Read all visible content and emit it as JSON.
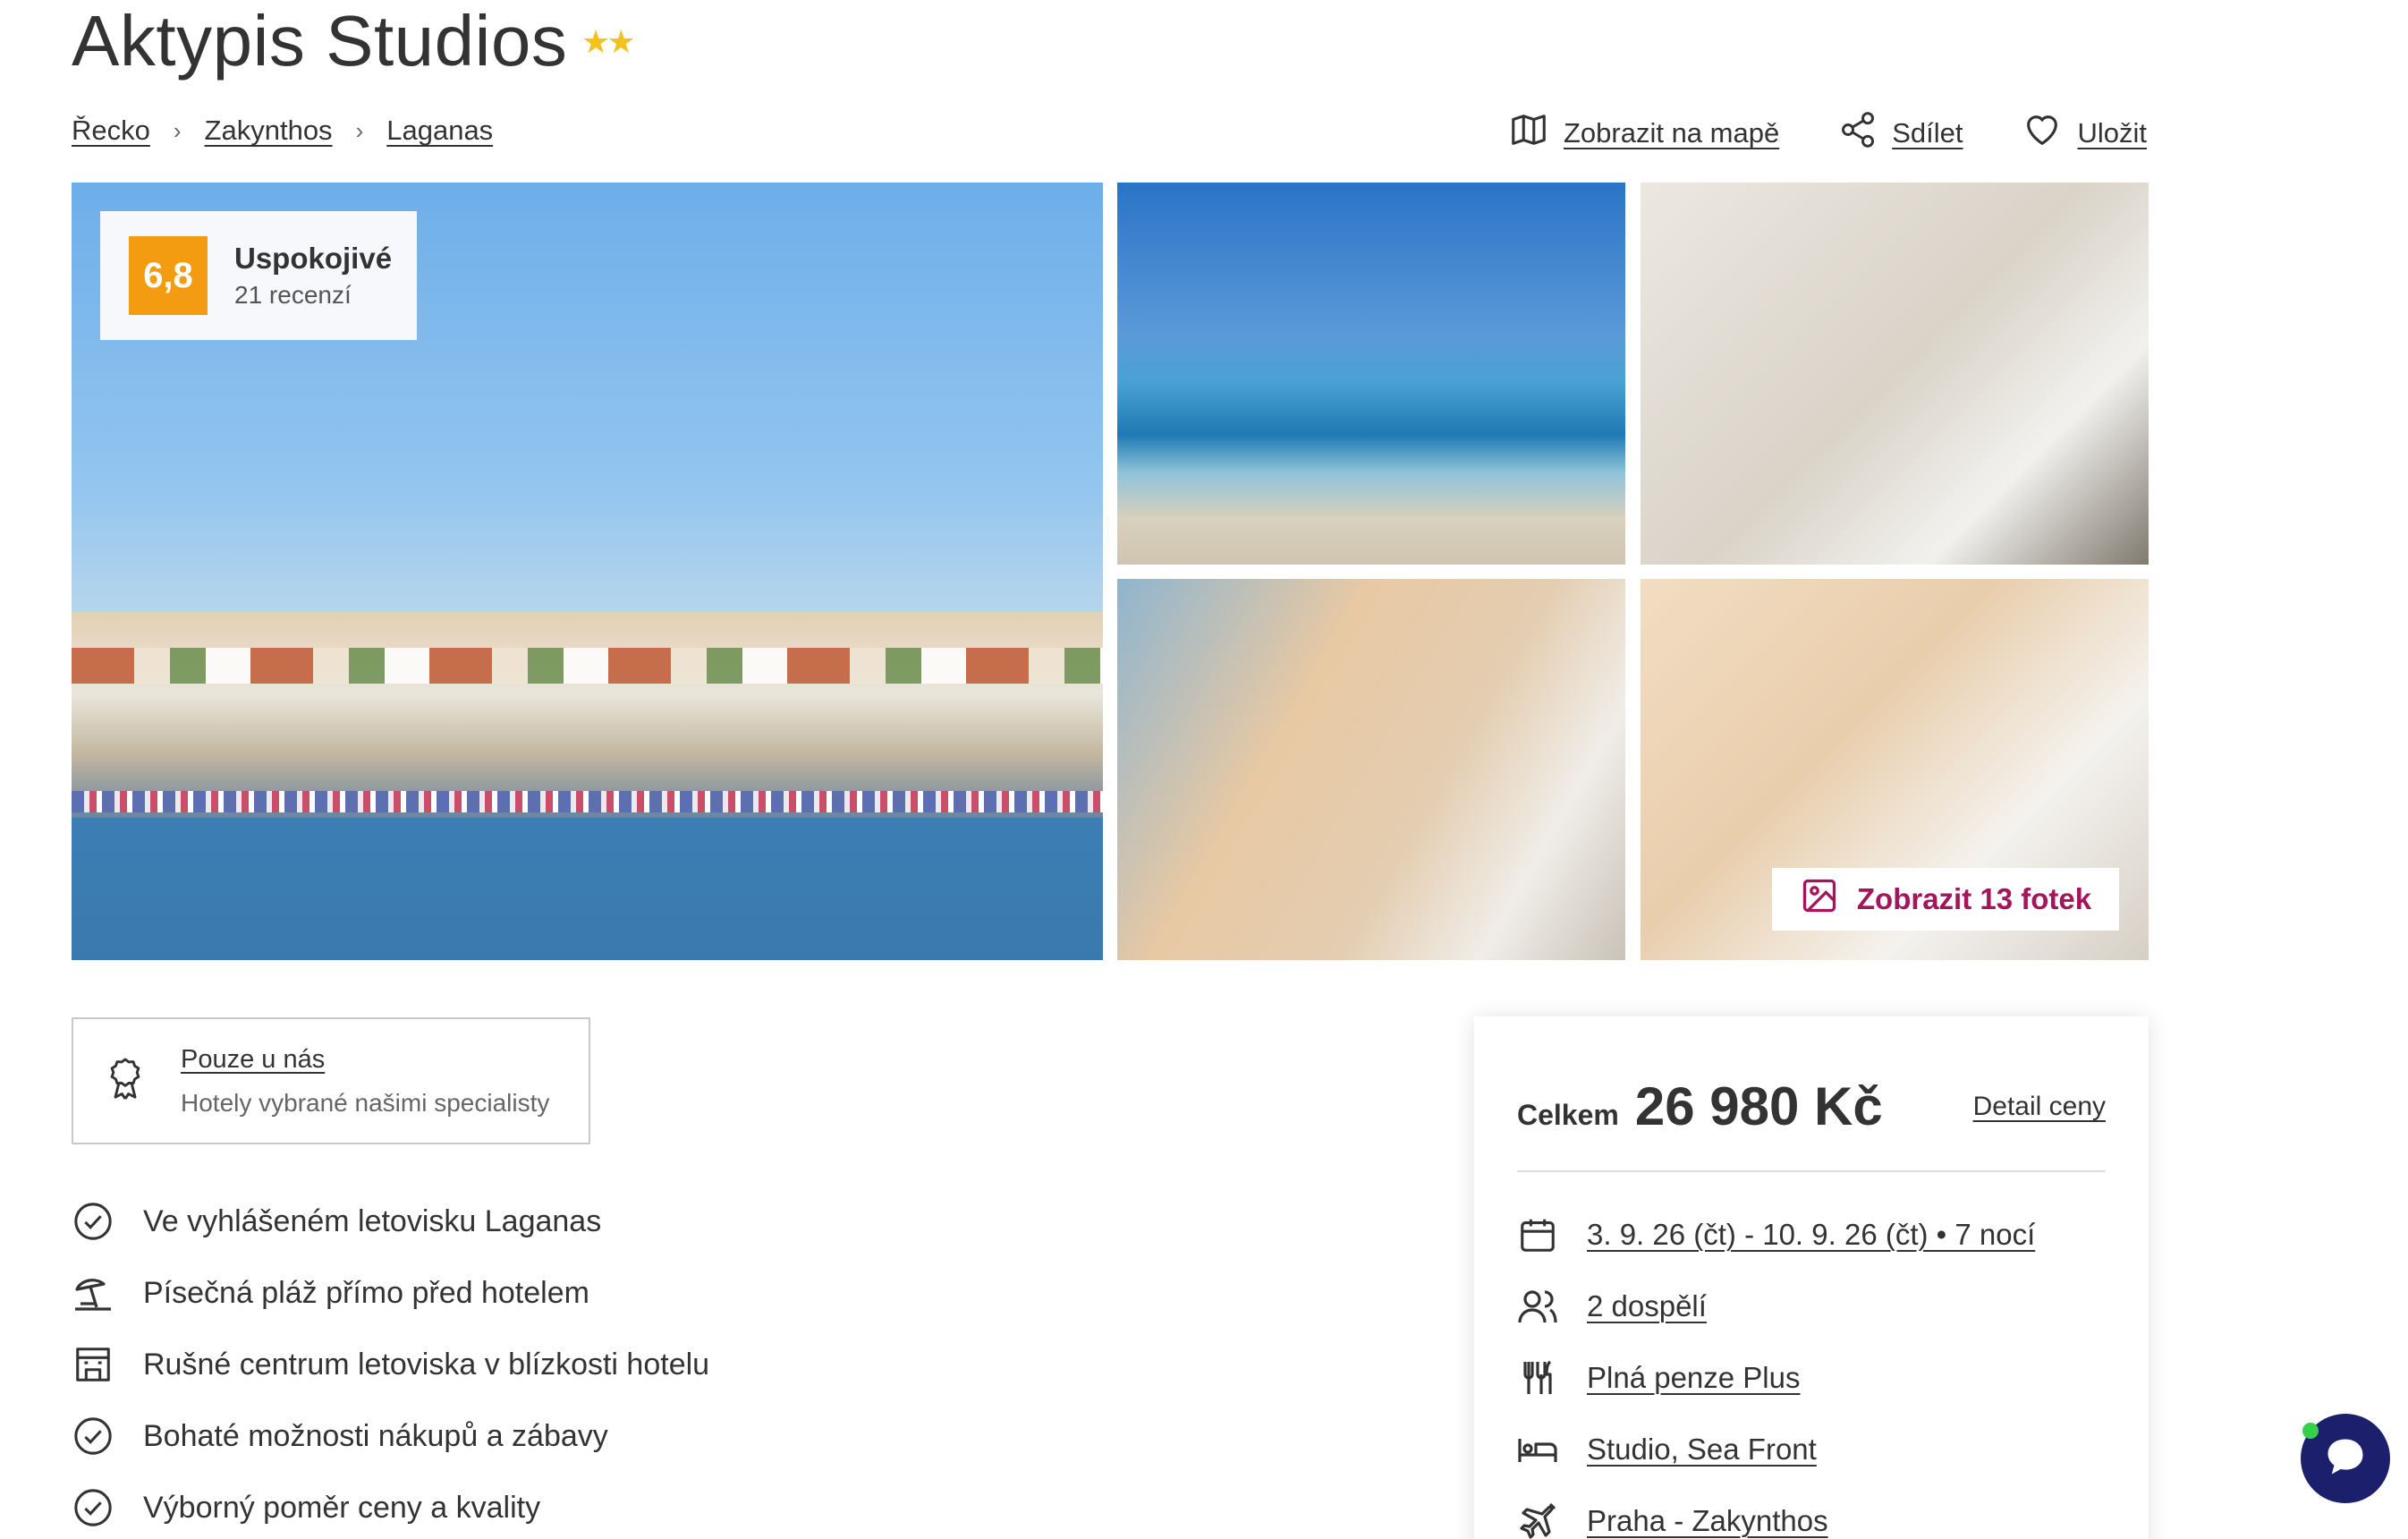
{
  "hotel": {
    "name": "Aktypis Studios",
    "stars": "★★"
  },
  "breadcrumb": [
    {
      "label": "Řecko"
    },
    {
      "label": "Zakynthos"
    },
    {
      "label": "Laganas"
    }
  ],
  "actions": {
    "map": "Zobrazit na mapě",
    "share": "Sdílet",
    "save": "Uložit"
  },
  "rating": {
    "score": "6,8",
    "label": "Uspokojivé",
    "reviews": "21 recenzí"
  },
  "gallery": {
    "show_photos": "Zobrazit 13 fotek"
  },
  "exclusive": {
    "title": "Pouze u nás",
    "subtitle": "Hotely vybrané našimi specialisty"
  },
  "features": [
    {
      "icon": "check-circle-icon",
      "text": "Ve vyhlášeném letovisku Laganas"
    },
    {
      "icon": "beach-umbrella-icon",
      "text": "Písečná pláž přímo před hotelem"
    },
    {
      "icon": "shop-icon",
      "text": "Rušné centrum letoviska v blízkosti hotelu"
    },
    {
      "icon": "check-circle-icon",
      "text": "Bohaté možnosti nákupů a zábavy"
    },
    {
      "icon": "check-circle-icon",
      "text": "Výborný poměr ceny a kvality"
    }
  ],
  "price": {
    "total_label": "Celkem",
    "total_value": "26 980 Kč",
    "detail_link": "Detail ceny",
    "dates": "3. 9. 26 (čt) - 10. 9. 26 (čt) • 7 nocí",
    "guests": "2 dospělí",
    "board": "Plná penze Plus",
    "room": "Studio, Sea Front",
    "flight": "Praha - Zakynthos"
  },
  "colors": {
    "score_bg": "#f39c12",
    "accent": "#a3165b",
    "chat": "#1c1f6b",
    "stars": "#f3c21b"
  }
}
